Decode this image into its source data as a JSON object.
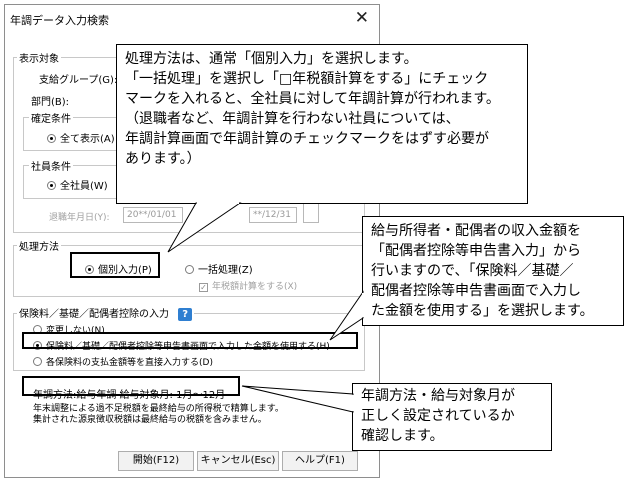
{
  "window": {
    "title": "年調データ入力検索",
    "close_glyph": "✕"
  },
  "display_target": {
    "title": "表示対象",
    "support_group_label": "支給グループ(G):",
    "department_label": "部門(B):",
    "confirm_conditions": {
      "title": "確定条件",
      "all_display": "全て表示(A)"
    },
    "employee_conditions": {
      "title": "社員条件",
      "all_employees": "全社員(W)"
    },
    "retire_month_label": "退職年月日(Y):",
    "retire_from": "20**/01/01",
    "retire_to": "**/12/31"
  },
  "processing_method": {
    "title": "処理方法",
    "individual": "個別入力(P)",
    "batch": "一括処理(Z)",
    "year_tax_calc": "年税額計算をする(X)"
  },
  "insurance": {
    "title": "保険料／基礎／配偶者控除の入力",
    "help_glyph": "?",
    "options": [
      "変更しない(N)",
      "保険料／基礎／配偶者控除等申告書画面で入力した金額を使用する(H)",
      "各保険料の支払金額等を直接入力する(D)"
    ]
  },
  "info": {
    "summary": "年調方法:給与年調  給与対象月: 1月～12月",
    "line1": "年末調整による過不足税額を最終給与の所得税で精算します。",
    "line2": "集計された源泉徴収税額は最終給与の税額を含みません。"
  },
  "buttons": {
    "start": "開始(F12)",
    "cancel": "キャンセル(Esc)",
    "help": "ヘルプ(F1)"
  },
  "callouts": {
    "c1": [
      "処理方法は、通常「個別入力」を選択します。",
      "「一括処理」を選択し「□年税額計算をする」にチェック",
      "マークを入れると、全社員に対して年調計算が行われます。",
      "（退職者など、年調計算を行わない社員については、",
      "年調計算画面で年調計算のチェックマークをはずす必要が",
      "あります。）"
    ],
    "c2": [
      "給与所得者・配偶者の収入金額を",
      "「配偶者控除等申告書入力」から",
      "行いますので、「保険料／基礎／",
      "配偶者控除等申告書画面で入力し",
      "た金額を使用する」を選択します。"
    ],
    "c3": [
      "年調方法・給与対象月が",
      "正しく設定されているか",
      "確認します。"
    ]
  }
}
